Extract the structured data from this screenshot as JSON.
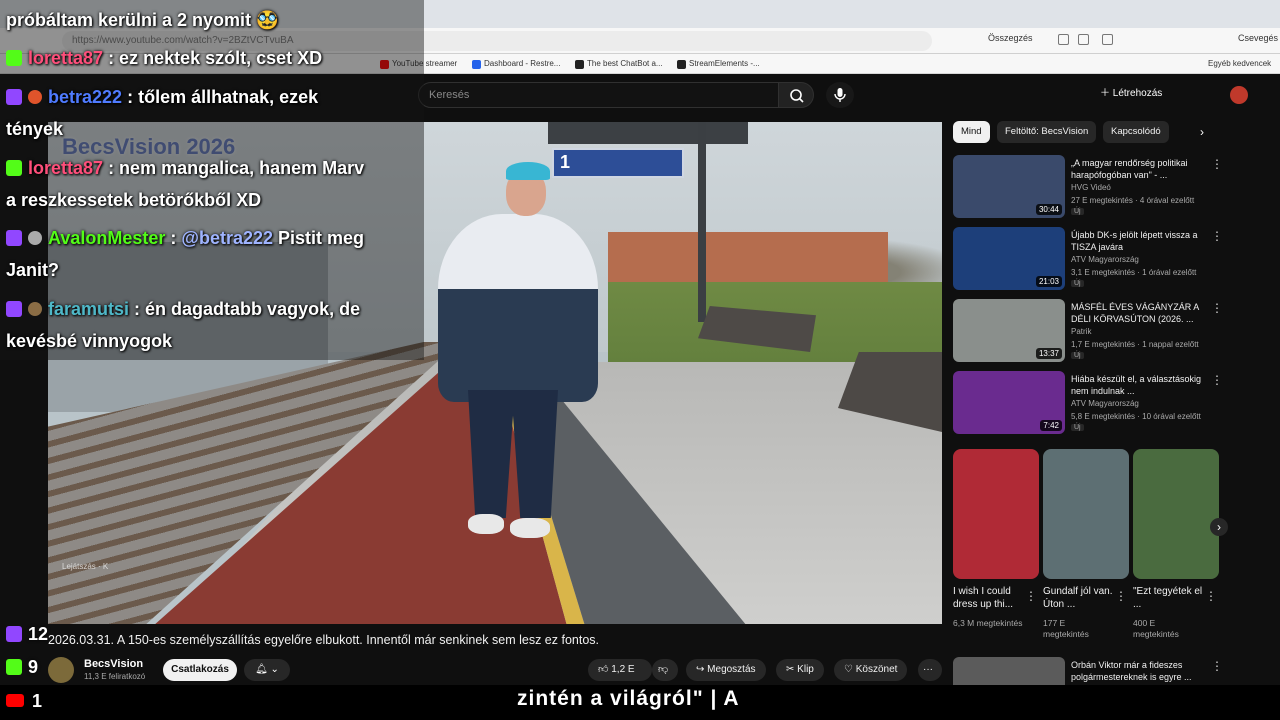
{
  "browser": {
    "url": "https://www.youtube.com/watch?v=2BZtVCTvuBA",
    "bookmarks": [
      {
        "label": "YouTube streamer",
        "color": "#ff0000"
      },
      {
        "label": "Dashboard - Restre...",
        "color": "#2563eb"
      },
      {
        "label": "The best ChatBot a...",
        "color": "#222222"
      },
      {
        "label": "StreamElements -...",
        "color": "#222222"
      }
    ],
    "right_label": "Összegzés",
    "profile_label": "Csevegés",
    "other_bookmarks": "Egyéb kedvencek"
  },
  "youtube": {
    "search_placeholder": "Keresés",
    "create_label": "Létrehozás",
    "video": {
      "sign_number": "1",
      "overlay_text": "BecsVision 2026",
      "watermark": "Lejátszás · K",
      "title": "2026.03.31. A 150-es személyszállítás egyelőre elbukott. Innentől már senkinek sem lesz ez fontos."
    },
    "channel": {
      "name": "BecsVision",
      "subscribers": "11,3 E feliratkozó",
      "join_label": "Csatlakozás"
    },
    "actions": {
      "likes": "1,2 E",
      "share": "Megosztás",
      "clip": "Klip",
      "thanks": "Köszönet",
      "more": "···"
    },
    "chips": [
      "Mind",
      "Feltöltő: BecsVision",
      "Kapcsolódó"
    ],
    "recommendations": [
      {
        "title": "„A magyar rendőrség politikai harapófogóban van\" - ...",
        "channel": "HVG Videó",
        "meta": "27 E megtekintés · 4 órával ezelőtt",
        "badge": "Új",
        "duration": "30:44",
        "thumb_color": "#3a4a6b"
      },
      {
        "title": "Újabb DK-s jelölt lépett vissza a TISZA javára",
        "channel": "ATV Magyarország",
        "meta": "3,1 E megtekintés · 1 órával ezelőtt",
        "badge": "Új",
        "duration": "21:03",
        "thumb_color": "#1d3f7a"
      },
      {
        "title": "MÁSFÉL ÉVES VÁGÁNYZÁR A DÉLI KÖRVASÚTON (2026. ...",
        "channel": "Patrik",
        "meta": "1,7 E megtekintés · 1 nappal ezelőtt",
        "badge": "Új",
        "duration": "13:37",
        "thumb_color": "#8a8f8c"
      },
      {
        "title": "Hiába készült el, a választásokig nem indulnak ...",
        "channel": "ATV Magyarország",
        "meta": "5,8 E megtekintés · 10 órával ezelőtt",
        "badge": "Új",
        "duration": "7:42",
        "thumb_color": "#6a2b8f"
      }
    ],
    "shorts": [
      {
        "title": "I wish I could dress up thi...",
        "views": "6,3 M megtekintés",
        "thumb_color": "#b02a36"
      },
      {
        "title": "Gundalf jól van. Úton ...",
        "views": "177 E megtekintés",
        "thumb_color": "#5d6f73"
      },
      {
        "title": "\"Ezt tegyétek el ...",
        "views": "400 E megtekintés",
        "thumb_color": "#4a6b3f"
      }
    ],
    "bottom_rec": {
      "title": "Orbán Viktor már a fideszes polgármestereknek is egyre ...",
      "thumb_color": "#5b5b5b"
    }
  },
  "chat": [
    {
      "platform": "none",
      "user": "",
      "user_color": "#ffffff",
      "text": "próbáltam kerülni a 2 nyomit"
    },
    {
      "platform": "kick",
      "user": "loretta87",
      "user_color": "#ff4f7b",
      "text": ": ez nektek szólt, cset XD"
    },
    {
      "platform": "twitch",
      "user": "betra222",
      "user_color": "#4f7bff",
      "text": ": tőlem állhatnak, ezek",
      "cont": "tények"
    },
    {
      "platform": "kick",
      "user": "loretta87",
      "user_color": "#ff4f7b",
      "text": ": nem mangalica, hanem Marv",
      "cont": "a reszkessetek betörőkből XD"
    },
    {
      "platform": "twitch",
      "user": "AvalonMester",
      "user_color": "#53fc18",
      "text": ": ",
      "mention": "@betra222",
      "tail": " Pistit meg",
      "cont": "Janit?"
    },
    {
      "platform": "twitch",
      "user": "faramutsi",
      "user_color": "#4fb8c8",
      "text": ": én dagadtabb vagyok, de",
      "cont": "kevésbé vinnyogok"
    }
  ],
  "counters": {
    "twitch_viewers": "12",
    "kick_viewers": "9",
    "youtube_viewers": "1"
  },
  "ticker": "zintén a világról\" | A"
}
